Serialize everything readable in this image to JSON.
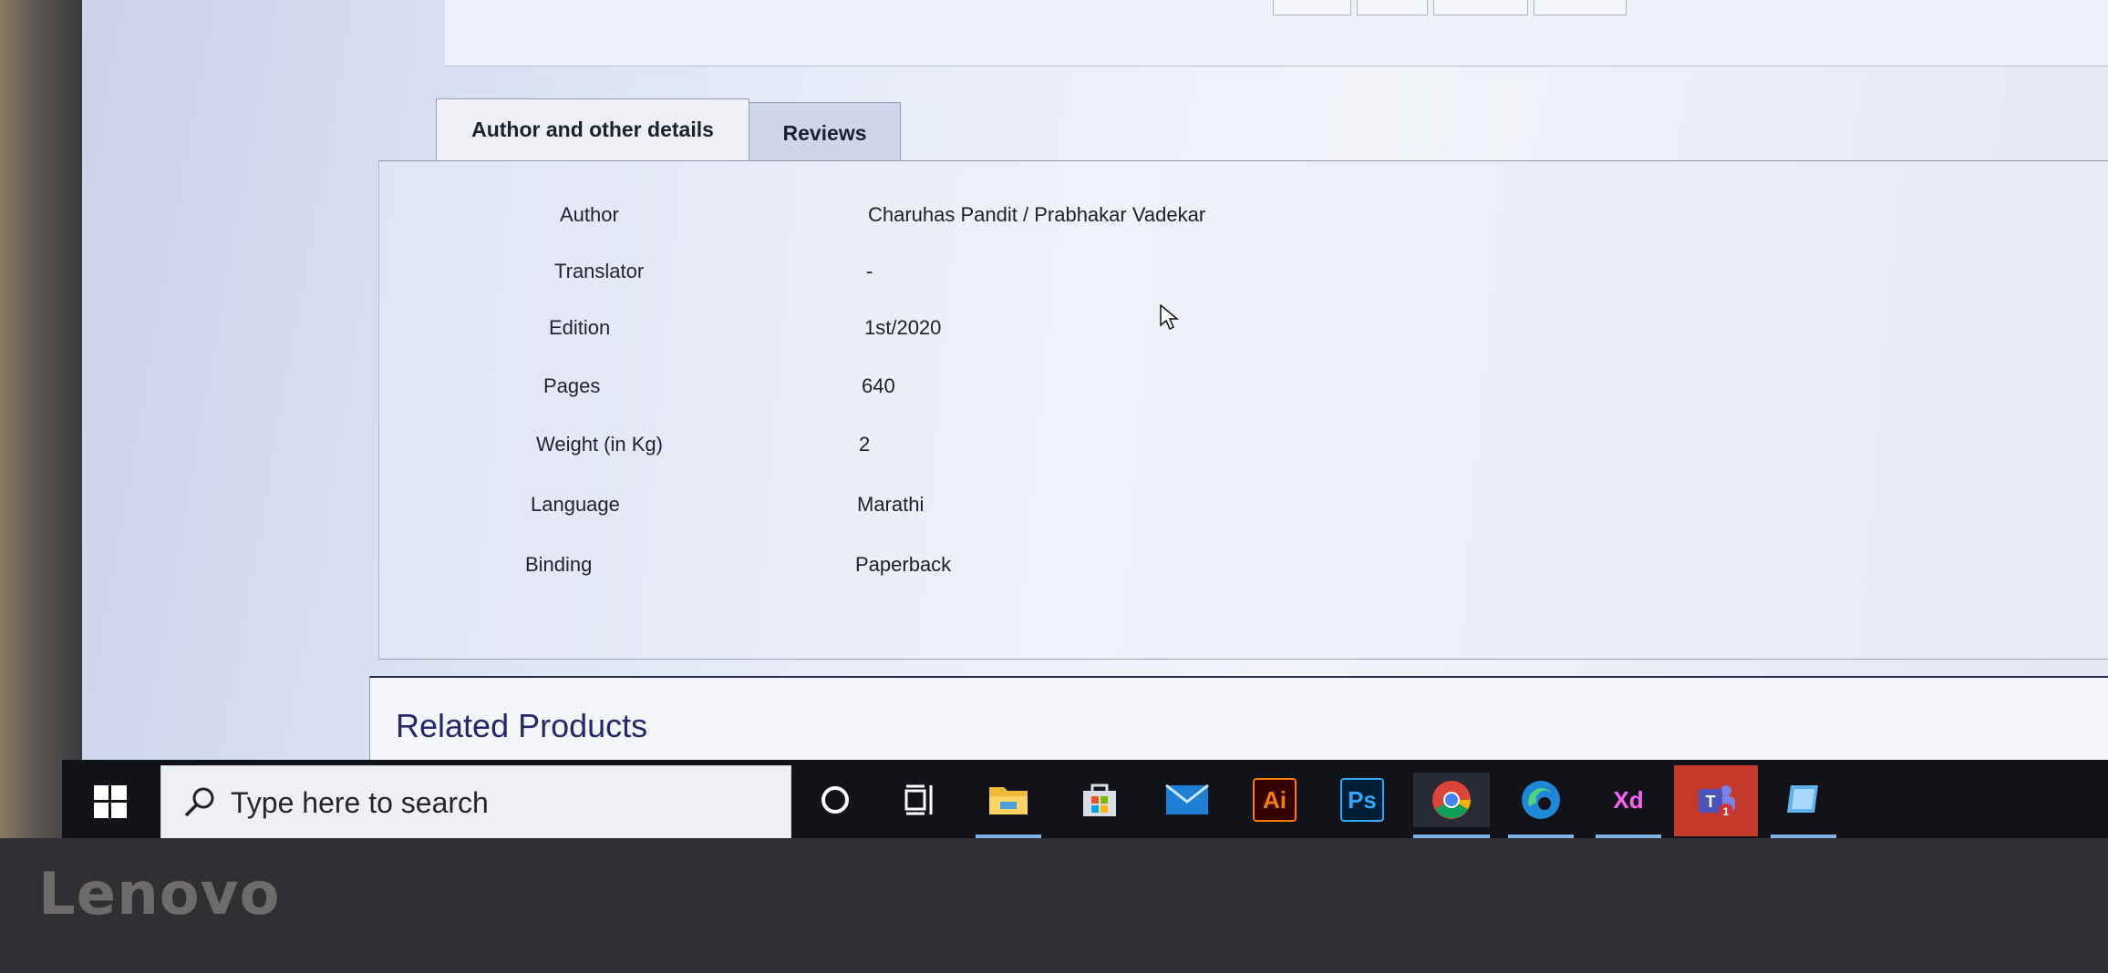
{
  "tabs": [
    {
      "label": "Author and other details",
      "active": true
    },
    {
      "label": "Reviews",
      "active": false
    }
  ],
  "details": [
    {
      "label": "Author",
      "value": "Charuhas Pandit / Prabhakar Vadekar"
    },
    {
      "label": "Translator",
      "value": "-"
    },
    {
      "label": "Edition",
      "value": "1st/2020"
    },
    {
      "label": "Pages",
      "value": "640"
    },
    {
      "label": "Weight (in Kg)",
      "value": "2"
    },
    {
      "label": "Language",
      "value": "Marathi"
    },
    {
      "label": "Binding",
      "value": "Paperback"
    }
  ],
  "related": {
    "title": "Related Products"
  },
  "taskbar": {
    "search_placeholder": "Type here to search",
    "apps": [
      {
        "icon": "cortana-circle-icon"
      },
      {
        "icon": "task-view-icon"
      },
      {
        "icon": "file-explorer-icon",
        "label": ""
      },
      {
        "icon": "microsoft-store-icon"
      },
      {
        "icon": "mail-icon"
      },
      {
        "icon": "illustrator-icon",
        "label": "Ai"
      },
      {
        "icon": "photoshop-icon",
        "label": "Ps"
      },
      {
        "icon": "chrome-icon"
      },
      {
        "icon": "edge-icon"
      },
      {
        "icon": "adobe-xd-icon",
        "label": "Xd"
      },
      {
        "icon": "teams-icon",
        "badge": "1"
      },
      {
        "icon": "remote-desktop-icon"
      }
    ]
  },
  "device": {
    "brand": "Lenovo"
  },
  "colors": {
    "tab_text": "#1d2033",
    "related_title": "#24286b",
    "taskbar": "#121318",
    "taskbar_underline": "#7fb2e6"
  }
}
